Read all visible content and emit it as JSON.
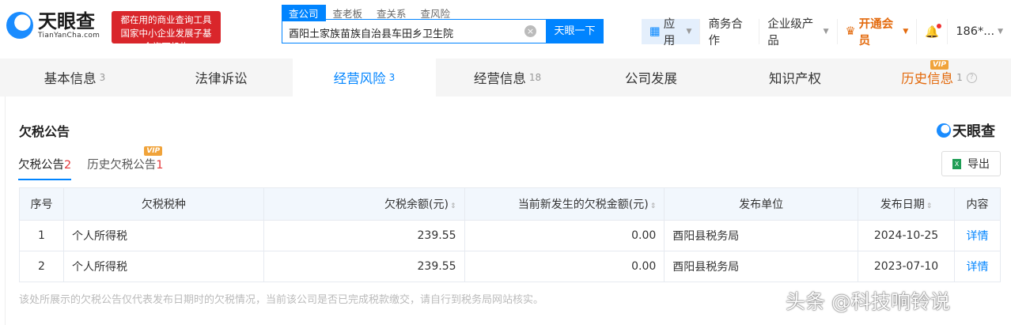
{
  "header": {
    "logo_cn": "天眼查",
    "logo_en": "TianYanCha.com",
    "slogan": [
      "都在用的商业查询工具",
      "国家中小企业发展子基金旗下机构"
    ],
    "search_tabs": [
      "查公司",
      "查老板",
      "查关系",
      "查风险"
    ],
    "search_value": "酉阳土家族苗族自治县车田乡卫生院",
    "search_button": "天眼一下",
    "nav": {
      "apps": "应用",
      "business": "商务合作",
      "enterprise": "企业级产品",
      "vip": "开通会员",
      "user": "186*..."
    }
  },
  "tabs": [
    {
      "label": "基本信息",
      "count": "3"
    },
    {
      "label": "法律诉讼",
      "count": ""
    },
    {
      "label": "经营风险",
      "count": "3"
    },
    {
      "label": "经营信息",
      "count": "18"
    },
    {
      "label": "公司发展",
      "count": ""
    },
    {
      "label": "知识产权",
      "count": ""
    },
    {
      "label": "历史信息",
      "count": "1",
      "vip": "VIP"
    }
  ],
  "section": {
    "title": "欠税公告",
    "brand": "天眼查",
    "subtabs": [
      {
        "label": "欠税公告",
        "count": "2"
      },
      {
        "label": "历史欠税公告",
        "count": "1",
        "vip": "VIP"
      }
    ],
    "export": "导出"
  },
  "table": {
    "headers": [
      "序号",
      "欠税税种",
      "欠税余额(元)",
      "当前新发生的欠税金额(元)",
      "发布单位",
      "发布日期",
      "内容"
    ],
    "rows": [
      [
        "1",
        "个人所得税",
        "239.55",
        "0.00",
        "酉阳县税务局",
        "2024-10-25",
        "详情"
      ],
      [
        "2",
        "个人所得税",
        "239.55",
        "0.00",
        "酉阳县税务局",
        "2023-07-10",
        "详情"
      ]
    ]
  },
  "note": "该处所展示的欠税公告仅代表发布日期时的欠税情况，当前该公司是否已完成税款缴交，请自行到税务局网站核实。",
  "watermark": "头条 @科技响铃说"
}
